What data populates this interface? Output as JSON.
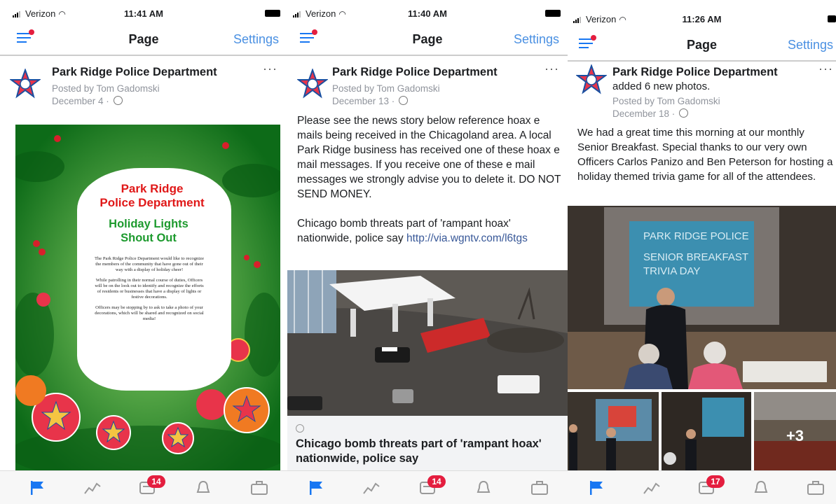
{
  "colors": {
    "accent": "#1877f2",
    "badge": "#e41e3f",
    "link": "#385898",
    "settings": "#4a90e2"
  },
  "panels": [
    {
      "status": {
        "carrier": "Verizon",
        "time": "11:41 AM"
      },
      "nav": {
        "title": "Page",
        "settings": "Settings"
      },
      "post": {
        "page_name": "Park Ridge Police Department",
        "posted_by": "Posted by Tom Gadomski",
        "date": "December 4 ·",
        "more": "···"
      },
      "flyer": {
        "title1": "Park Ridge",
        "title2": "Police Department",
        "sub1": "Holiday Lights",
        "sub2": "Shout Out",
        "body1": "The Park Ridge Police Department would like to recognize the members of the community that have gone out of their way with a display of holiday cheer!",
        "body2": "While patrolling in their normal course of duties, Officers will be on the look out to identify and recognize the efforts of residents or businesses that have a display of lights or festive decorations.",
        "body3": "Officers may be stopping by to ask to take a photo of your decorations, which will be shared and recognized on social media!"
      },
      "tabbar": {
        "notif_count": "14"
      }
    },
    {
      "status": {
        "carrier": "Verizon",
        "time": "11:40 AM"
      },
      "nav": {
        "title": "Page",
        "settings": "Settings"
      },
      "post": {
        "page_name": "Park Ridge Police Department",
        "posted_by": "Posted by Tom Gadomski",
        "date": "December 13 ·",
        "more": "···",
        "text": "Please see the news story below reference hoax e mails being received in the Chicagoland area. A local Park Ridge business has received one of these hoax e mail messages. If you receive one of these e mail messages we strongly advise you to delete it. DO NOT SEND MONEY.\n\nChicago bomb threats part of 'rampant hoax' nationwide, police say ",
        "link": "http://via.wgntv.com/l6tgs"
      },
      "link_card": {
        "title": "Chicago bomb threats part of 'rampant hoax' nationwide, police say"
      },
      "tabbar": {
        "notif_count": "14"
      }
    },
    {
      "status": {
        "carrier": "Verizon",
        "time": "11:26 AM"
      },
      "nav": {
        "title": "Page",
        "settings": "Settings"
      },
      "post": {
        "page_name": "Park Ridge Police Department",
        "action": "added 6 new photos.",
        "posted_by": "Posted by Tom Gadomski",
        "date": "December 18 ·",
        "more": "···",
        "text": "We had a great time this morning at our monthly Senior Breakfast. Special thanks to our very own Officers Carlos Panizo and Ben Peterson for hosting a holiday themed trivia game for all of the attendees."
      },
      "slide": {
        "line1": "PARK RIDGE POLICE",
        "line2": "SENIOR BREAKFAST",
        "line3": "TRIVIA DAY"
      },
      "more_photos": "+3",
      "tabbar": {
        "notif_count": "17"
      }
    }
  ]
}
